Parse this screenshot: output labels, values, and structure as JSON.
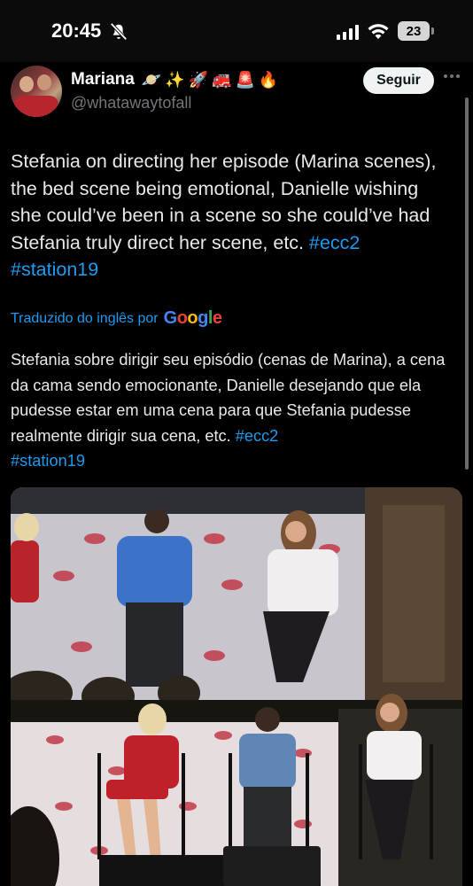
{
  "status_bar": {
    "time": "20:45",
    "battery": "23",
    "icons": [
      "bell-slash-icon",
      "signal-bars-icon",
      "wifi-icon",
      "battery-icon"
    ]
  },
  "tweet": {
    "author": {
      "display_name": "Mariana",
      "emojis": [
        "🪐",
        "✨",
        "🚀",
        "🚒",
        "🚨",
        "🔥"
      ],
      "handle": "@whatawaytofall"
    },
    "follow_label": "Seguir",
    "text_parts": [
      "Stefania on directing her episode (Marina scenes), the bed scene being emotional, Danielle wishing she could’ve been in a scene so she could’ve had Stefania truly direct her scene, etc. ",
      "#ecc2",
      "#station19"
    ],
    "translated_label": "Traduzido do inglês por",
    "translator_brand": "Google",
    "translation_parts": [
      "Stefania sobre dirigir seu episódio (cenas de Marina), a cena da cama sendo emocionante, Danielle desejando que ela pudesse estar em uma cena para que Stefania pudesse realmente dirigir sua cena, etc. ",
      "#ecc2",
      "#station19"
    ]
  },
  "colors": {
    "background": "#000000",
    "text": "#e7e9ea",
    "secondary_text": "#71767b",
    "link": "#1d9bf0",
    "follow_button_bg": "#eff3f4"
  }
}
